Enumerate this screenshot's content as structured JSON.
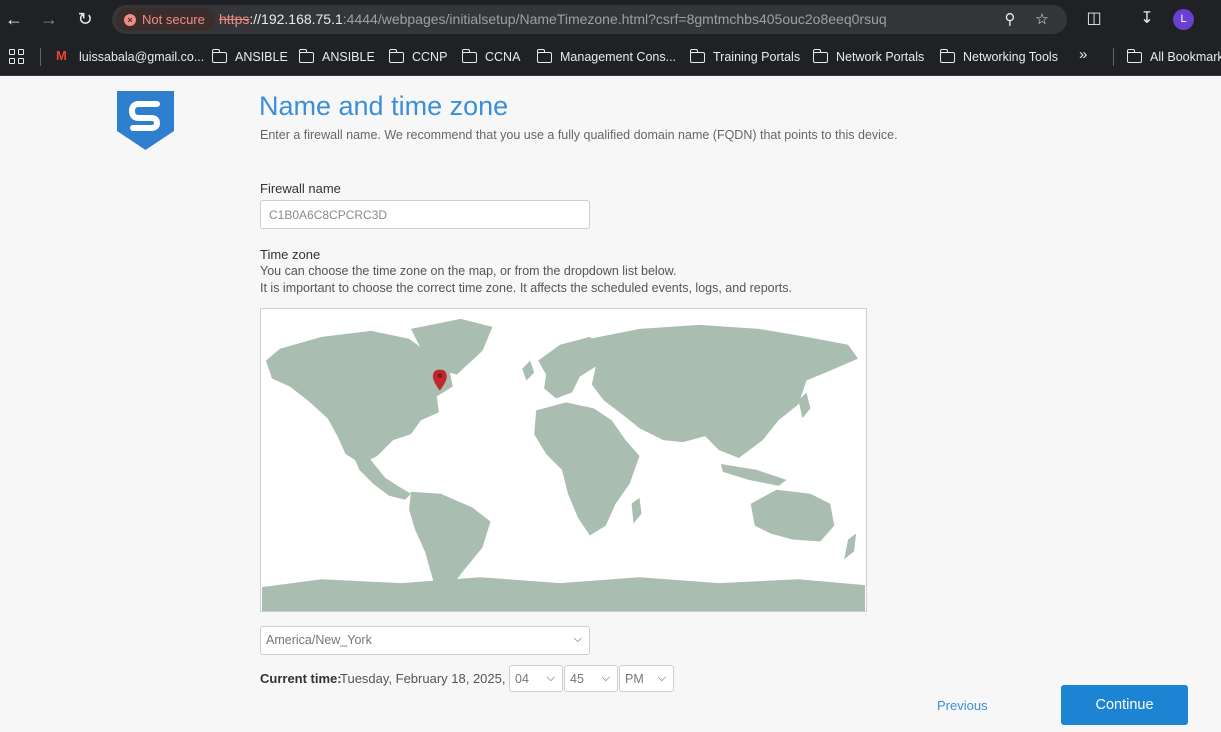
{
  "browser": {
    "security_label": "Not secure",
    "url_scheme": "https",
    "url_host": "://192.168.75.1",
    "url_rest": ":4444/webpages/initialsetup/NameTimezone.html?csrf=8gmtmchbs405ouc2o8eeq0rsuq",
    "profile_initial": "L",
    "bookmarks": [
      {
        "label": "luissabala@gmail.co...",
        "icon": "gmail-icon"
      },
      {
        "label": "ANSIBLE",
        "icon": "folder-icon"
      },
      {
        "label": "ANSIBLE",
        "icon": "folder-icon"
      },
      {
        "label": "CCNP",
        "icon": "folder-icon"
      },
      {
        "label": "CCNA",
        "icon": "folder-icon"
      },
      {
        "label": "Management Cons...",
        "icon": "folder-icon"
      },
      {
        "label": "Training Portals",
        "icon": "folder-icon"
      },
      {
        "label": "Network Portals",
        "icon": "folder-icon"
      },
      {
        "label": "Networking Tools",
        "icon": "folder-icon"
      },
      {
        "label": "All Bookmarks",
        "icon": "folder-icon"
      }
    ]
  },
  "page": {
    "title": "Name and time zone",
    "subtitle": "Enter a firewall name. We recommend that you use a fully qualified domain name (FQDN) that points to this device.",
    "firewall_label": "Firewall name",
    "firewall_value": "C1B0A6C8CPCRC3D",
    "timezone_label": "Time zone",
    "timezone_help_1": "You can choose the time zone on the map, or from the dropdown list below.",
    "timezone_help_2": "It is important to choose the correct time zone. It affects the scheduled events, logs, and reports.",
    "timezone_value": "America/New_York",
    "current_time_label": "Current time:",
    "current_date": "Tuesday, February 18, 2025,",
    "hour": "04",
    "minute": "45",
    "ampm": "PM",
    "previous_label": "Previous",
    "continue_label": "Continue"
  },
  "colors": {
    "accent": "#1d84d4",
    "title": "#3b8fd9",
    "map_land": "#a9bdb1",
    "marker": "#c0282b"
  }
}
